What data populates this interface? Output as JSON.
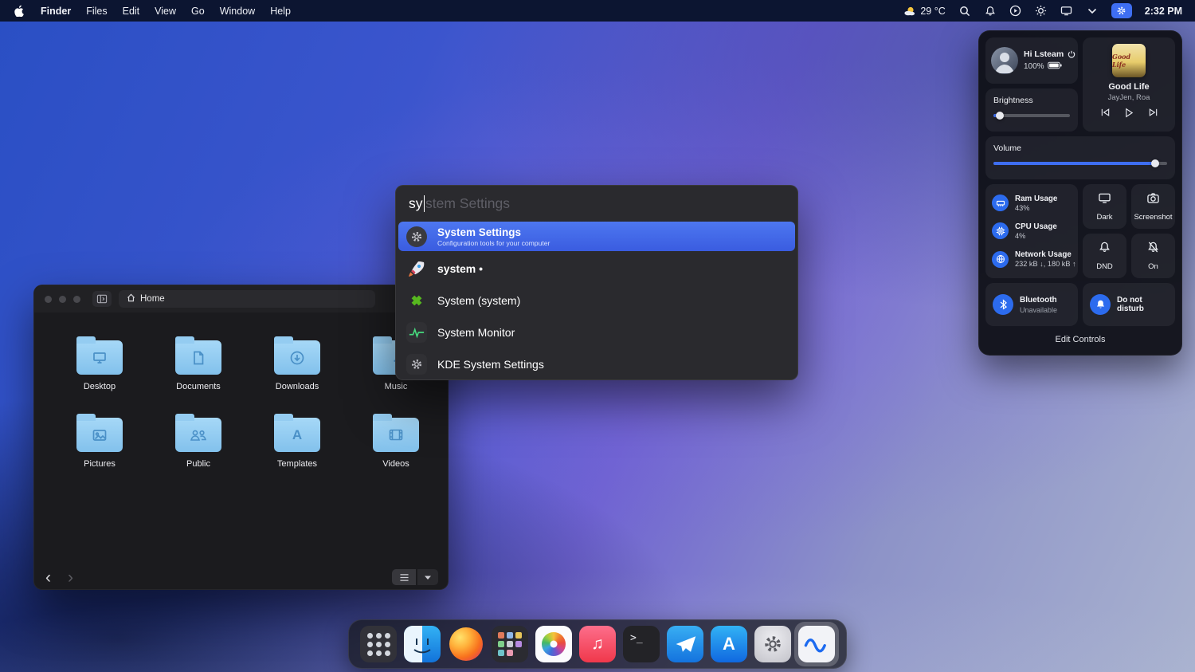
{
  "menubar": {
    "items": [
      "Finder",
      "Files",
      "Edit",
      "View",
      "Go",
      "Window",
      "Help"
    ],
    "weather": "29 °C",
    "time": "2:32 PM"
  },
  "control_center": {
    "greeting": "Hi Lsteam",
    "battery": "100%",
    "media": {
      "title": "Good Life",
      "artists": "JayJen, Roa",
      "art_text": "Good Life"
    },
    "brightness": {
      "label": "Brightness",
      "percent": 8
    },
    "volume": {
      "label": "Volume",
      "percent": 93
    },
    "stats": [
      {
        "label": "Ram Usage",
        "value": "43%"
      },
      {
        "label": "CPU Usage",
        "value": "4%"
      },
      {
        "label": "Network Usage",
        "value": "232 kB ↓, 180 kB ↑"
      }
    ],
    "toggles": [
      {
        "label": "Dark",
        "icon": "display-icon"
      },
      {
        "label": "Screenshot",
        "icon": "camera-icon"
      },
      {
        "label": "DND",
        "icon": "bell-icon"
      },
      {
        "label": "On",
        "icon": "bell-slash-icon"
      }
    ],
    "bluetooth": {
      "label": "Bluetooth",
      "status": "Unavailable"
    },
    "do_not_disturb": {
      "label": "Do not disturb"
    },
    "edit_controls_label": "Edit Controls"
  },
  "launcher": {
    "query": "sy",
    "completion": "stem Settings",
    "results": [
      {
        "title": "System Settings",
        "subtitle": "Configuration tools for your computer",
        "icon": "gear-icon",
        "selected": true
      },
      {
        "title": "system •",
        "icon": "rocket-icon"
      },
      {
        "title": "System (system)",
        "icon": "green-cross-icon"
      },
      {
        "title": "System Monitor",
        "icon": "activity-graph-icon"
      },
      {
        "title": "KDE System Settings",
        "icon": "gear-icon"
      }
    ]
  },
  "file_manager": {
    "breadcrumb": "Home",
    "folders": [
      "Desktop",
      "Documents",
      "Downloads",
      "Music",
      "Pictures",
      "Public",
      "Templates",
      "Videos"
    ]
  },
  "dock": {
    "apps": [
      "launchpad",
      "finder",
      "firefox",
      "app-grid",
      "photos",
      "music",
      "terminal",
      "paper-plane-app",
      "app-store",
      "system-settings",
      "wave-app"
    ],
    "active_app": "wave-app"
  }
}
